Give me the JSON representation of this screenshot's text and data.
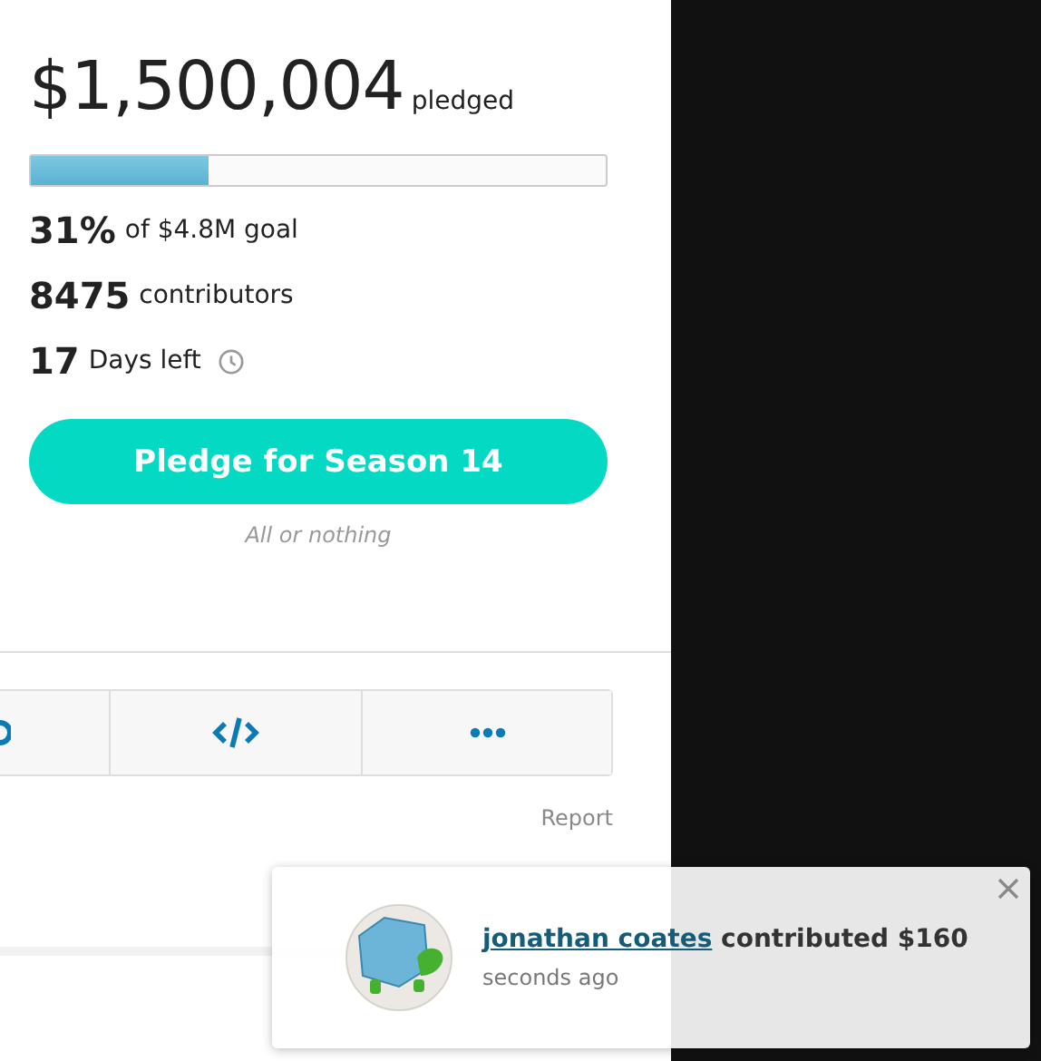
{
  "campaign": {
    "amount": "$1,500,004",
    "amount_label": "pledged",
    "progress": {
      "level": 0.31
    },
    "stats": [
      {
        "value": "31%",
        "label": "of $4.8M goal",
        "kind": "text"
      },
      {
        "value": "8475",
        "label": "contributors",
        "kind": "text"
      },
      {
        "value": "17",
        "label": "Days left",
        "kind": "clock"
      }
    ],
    "pledge_button": "Pledge for Season 14",
    "funding_note": "All or nothing"
  },
  "share_buttons": [
    {
      "kind": "partial"
    },
    {
      "kind": "embed"
    },
    {
      "kind": "more"
    }
  ],
  "report_link": "Report",
  "toast": {
    "name": "jonathan coates",
    "message": "contributed $160",
    "time": "seconds ago"
  }
}
